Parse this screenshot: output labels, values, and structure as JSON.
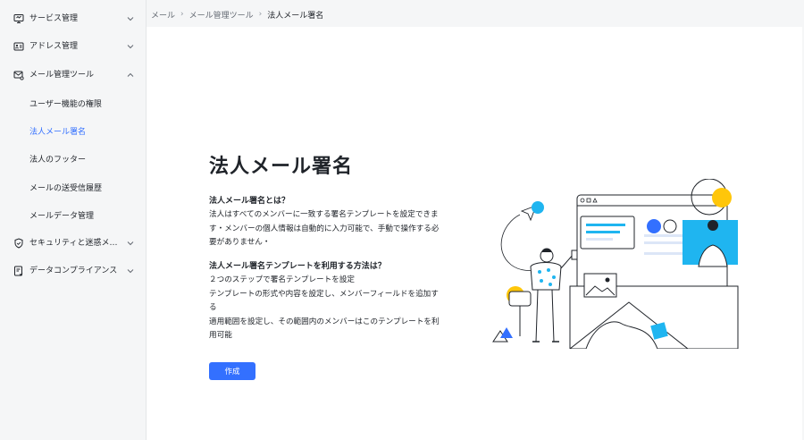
{
  "sidebar": {
    "items": [
      {
        "label": "サービス管理",
        "icon": "monitor-icon",
        "expanded": false
      },
      {
        "label": "アドレス管理",
        "icon": "contact-card-icon",
        "expanded": false
      },
      {
        "label": "メール管理ツール",
        "icon": "mail-settings-icon",
        "expanded": true
      },
      {
        "label": "セキュリティと迷惑メール",
        "icon": "shield-icon",
        "expanded": false
      },
      {
        "label": "データコンプライアンス",
        "icon": "compliance-doc-icon",
        "expanded": false
      }
    ],
    "subitems": [
      {
        "label": "ユーザー機能の権限",
        "active": false
      },
      {
        "label": "法人メール署名",
        "active": true
      },
      {
        "label": "法人のフッター",
        "active": false
      },
      {
        "label": "メールの送受信履歴",
        "active": false
      },
      {
        "label": "メールデータ管理",
        "active": false
      }
    ]
  },
  "breadcrumb": {
    "items": [
      "メール",
      "メール管理ツール",
      "法人メール署名"
    ]
  },
  "main": {
    "title": "法人メール署名",
    "section1_heading": "法人メール署名とは？",
    "section1_body": "法人はすべてのメンバーに一致する署名テンプレートを設定できます・メンバーの個人情報は自動的に入力可能で、手動で操作する必要がありません・",
    "section2_heading": "法人メール署名テンプレートを利用する方法は？",
    "section2_lines": [
      "２つのステップで署名テンプレートを設定",
      "テンプレートの形式や内容を設定し、メンバーフィールドを追加する",
      "適用範囲を設定し、その範囲内のメンバーはこのテンプレートを利用可能"
    ],
    "create_label": "作成"
  },
  "colors": {
    "accent": "#3370ff",
    "illustration_blue": "#1fb5f0",
    "illustration_yellow": "#ffc60a"
  }
}
